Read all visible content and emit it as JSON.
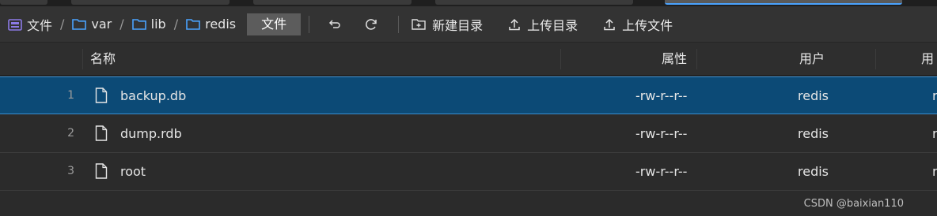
{
  "breadcrumb": {
    "root_label": "文件",
    "segments": [
      "var",
      "lib",
      "redis"
    ],
    "separator": "/"
  },
  "toolbar": {
    "current_button": "文件",
    "new_dir_label": "新建目录",
    "upload_dir_label": "上传目录",
    "upload_file_label": "上传文件"
  },
  "table": {
    "columns": {
      "name": "名称",
      "attr": "属性",
      "user": "用户",
      "group": "用户"
    },
    "rows": [
      {
        "index": "1",
        "name": "backup.db",
        "attr": "-rw-r--r--",
        "user": "redis",
        "group": "r",
        "selected": true
      },
      {
        "index": "2",
        "name": "dump.rdb",
        "attr": "-rw-r--r--",
        "user": "redis",
        "group": "r",
        "selected": false
      },
      {
        "index": "3",
        "name": "root",
        "attr": "-rw-r--r--",
        "user": "redis",
        "group": "r",
        "selected": false
      }
    ]
  },
  "watermark": "CSDN @baixian110",
  "colors": {
    "background": "#2b2b2b",
    "toolbar": "#333333",
    "selected_row": "#0c4a76",
    "folder_icon": "#4aa3ff",
    "root_icon": "#8c7ae6"
  }
}
